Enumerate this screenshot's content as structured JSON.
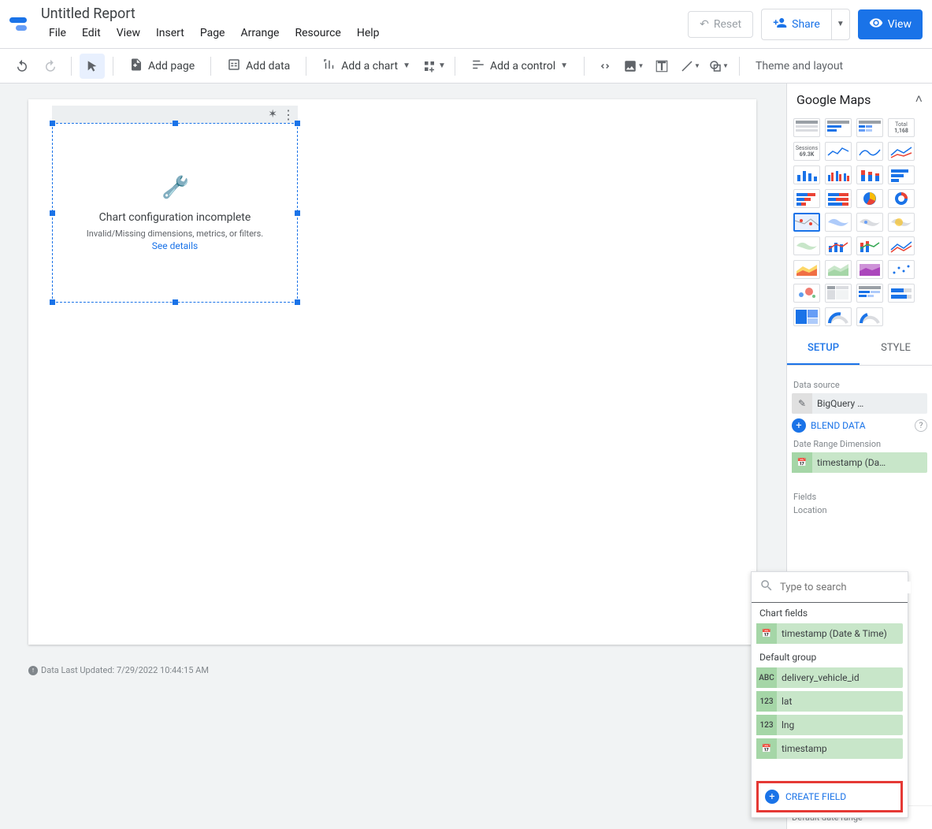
{
  "header": {
    "doc_title": "Untitled Report",
    "menu": [
      "File",
      "Edit",
      "View",
      "Insert",
      "Page",
      "Arrange",
      "Resource",
      "Help"
    ],
    "reset": "Reset",
    "share": "Share",
    "view": "View"
  },
  "toolbar": {
    "add_page": "Add page",
    "add_data": "Add data",
    "add_chart": "Add a chart",
    "add_control": "Add a control",
    "theme_layout": "Theme and layout"
  },
  "canvas": {
    "chart_error": {
      "title": "Chart configuration incomplete",
      "subtitle": "Invalid/Missing dimensions, metrics, or filters.",
      "link": "See details"
    },
    "footer": "Data Last Updated: 7/29/2022 10:44:15 AM"
  },
  "right_panel": {
    "title": "Google Maps",
    "tabs": {
      "setup": "SETUP",
      "style": "STYLE"
    },
    "data_source_label": "Data source",
    "data_source_value": "BigQuery …",
    "blend": "BLEND DATA",
    "date_range_dim_label": "Date Range Dimension",
    "date_range_dim_value": "timestamp (Da…",
    "fields_label": "Fields",
    "location_label": "Location",
    "default_range": "Default date range"
  },
  "field_picker": {
    "search_placeholder": "Type to search",
    "chart_fields_label": "Chart fields",
    "chart_fields": [
      {
        "icon": "cal",
        "label": "timestamp (Date & Time)"
      }
    ],
    "default_group_label": "Default group",
    "default_group": [
      {
        "icon": "ABC",
        "label": "delivery_vehicle_id"
      },
      {
        "icon": "123",
        "label": "lat"
      },
      {
        "icon": "123",
        "label": "lng"
      },
      {
        "icon": "cal",
        "label": "timestamp"
      }
    ],
    "create_field": "CREATE FIELD"
  }
}
